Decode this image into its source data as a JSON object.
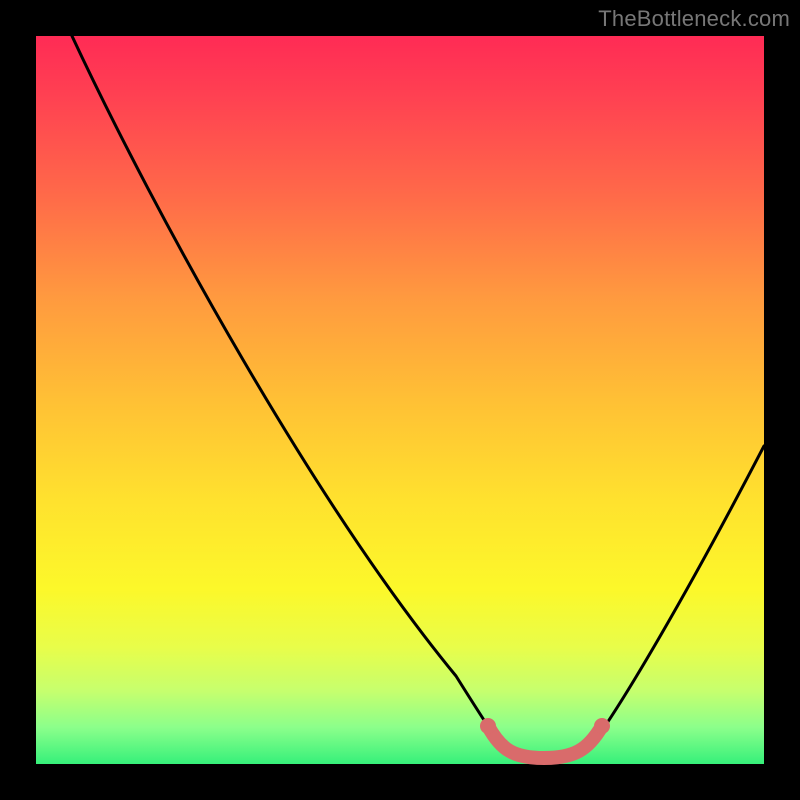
{
  "watermark": "TheBottleneck.com",
  "chart_data": {
    "type": "line",
    "title": "",
    "xlabel": "",
    "ylabel": "",
    "xlim": [
      0,
      100
    ],
    "ylim": [
      0,
      100
    ],
    "series": [
      {
        "name": "bottleneck-curve",
        "x": [
          5,
          10,
          15,
          20,
          25,
          30,
          35,
          40,
          45,
          50,
          55,
          60,
          62,
          65,
          70,
          75,
          78,
          80,
          85,
          90,
          95,
          100
        ],
        "y": [
          100,
          92,
          84,
          76,
          68,
          60,
          52,
          44,
          36,
          28,
          20,
          11,
          6,
          2,
          0,
          0,
          2,
          6,
          15,
          26,
          37,
          48
        ]
      },
      {
        "name": "highlight-band",
        "x": [
          62,
          65,
          70,
          75,
          78
        ],
        "y": [
          6,
          2,
          0,
          0,
          2
        ]
      }
    ],
    "gradient_stops": [
      {
        "pos": 0,
        "color": "#ff2b55"
      },
      {
        "pos": 50,
        "color": "#ffc035"
      },
      {
        "pos": 76,
        "color": "#fcf82a"
      },
      {
        "pos": 100,
        "color": "#36f07a"
      }
    ]
  }
}
